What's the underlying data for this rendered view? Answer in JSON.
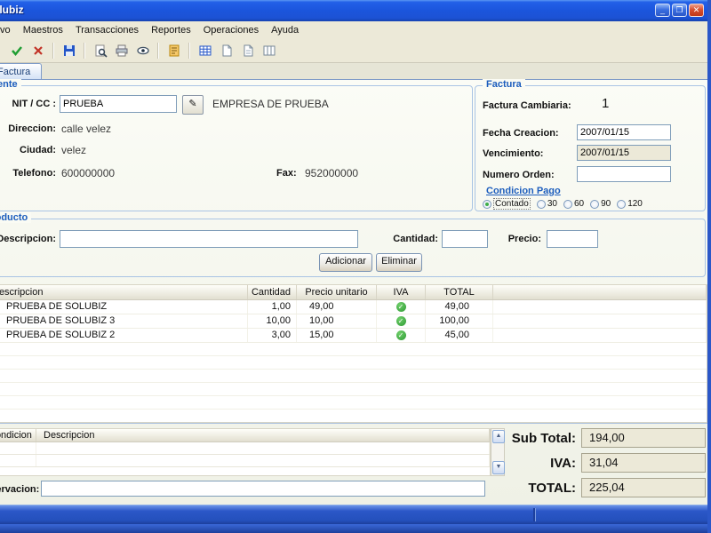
{
  "window": {
    "title": "Solubiz",
    "controls": {
      "minimize": "_",
      "maximize": "❐",
      "close": "✕"
    }
  },
  "menu": {
    "items": [
      "Archivo",
      "Maestros",
      "Transacciones",
      "Reportes",
      "Operaciones",
      "Ayuda"
    ]
  },
  "toolbar": {
    "icons": [
      "confirm-icon",
      "cancel-icon",
      "save-icon",
      "preview-icon",
      "print-icon",
      "view-icon",
      "notes-icon",
      "grid-icon",
      "document-icon",
      "document2-icon",
      "columns-icon"
    ]
  },
  "tabs": {
    "active": "Factura"
  },
  "client": {
    "caption": "Cliente",
    "nit_label": "NIT / CC :",
    "nit_value": "PRUEBA",
    "search_icon": "✎",
    "company_name": "EMPRESA DE PRUEBA",
    "address_label": "Direccion:",
    "address_value": "calle velez",
    "city_label": "Ciudad:",
    "city_value": "velez",
    "phone_label": "Telefono:",
    "phone_value": "600000000",
    "fax_label": "Fax:",
    "fax_value": "952000000"
  },
  "invoice": {
    "caption": "Factura",
    "cambiaria_label": "Factura Cambiaria:",
    "cambiaria_value": "1",
    "creation_label": "Fecha Creacion:",
    "creation_value": "2007/01/15",
    "due_label": "Vencimiento:",
    "due_value": "2007/01/15",
    "order_label": "Numero Orden:",
    "order_value": "",
    "payment_caption": "Condicion Pago",
    "payment_options": [
      {
        "label": "Contado",
        "selected": true
      },
      {
        "label": "30",
        "selected": false
      },
      {
        "label": "60",
        "selected": false
      },
      {
        "label": "90",
        "selected": false
      },
      {
        "label": "120",
        "selected": false
      }
    ]
  },
  "product": {
    "caption": "Producto",
    "description_label": "Descripcion:",
    "description_value": "",
    "quantity_label": "Cantidad:",
    "quantity_value": "",
    "price_label": "Precio:",
    "price_value": "",
    "add_button": "Adicionar",
    "delete_button": "Eliminar"
  },
  "items_table": {
    "columns": [
      "Descripcion",
      "Cantidad",
      "Precio unitario",
      "IVA",
      "TOTAL"
    ],
    "iva_check_icon": "✓",
    "rows": [
      {
        "description": "PRUEBA DE SOLUBIZ",
        "quantity": "1,00",
        "unit_price": "49,00",
        "iva": true,
        "total": "49,00"
      },
      {
        "description": "PRUEBA DE SOLUBIZ 3",
        "quantity": "10,00",
        "unit_price": "10,00",
        "iva": true,
        "total": "100,00"
      },
      {
        "description": "PRUEBA DE SOLUBIZ 2",
        "quantity": "3,00",
        "unit_price": "15,00",
        "iva": true,
        "total": "45,00"
      }
    ]
  },
  "conditions_table": {
    "columns": [
      "Condicion",
      "Descripcion"
    ],
    "scroll_up_icon": "▲",
    "scroll_down_icon": "▼"
  },
  "observation": {
    "label": "Observacion:",
    "value": ""
  },
  "totals": {
    "subtotal_label": "Sub Total:",
    "subtotal_value": "194,00",
    "iva_label": "IVA:",
    "iva_value": "31,04",
    "total_label": "TOTAL:",
    "total_value": "225,04"
  },
  "colors": {
    "title_blue": "#1b55dc",
    "caption_blue": "#1c5dbd",
    "field_border": "#7f9db9",
    "field_beige": "#ece9d8",
    "check_green": "#2e9a33"
  }
}
